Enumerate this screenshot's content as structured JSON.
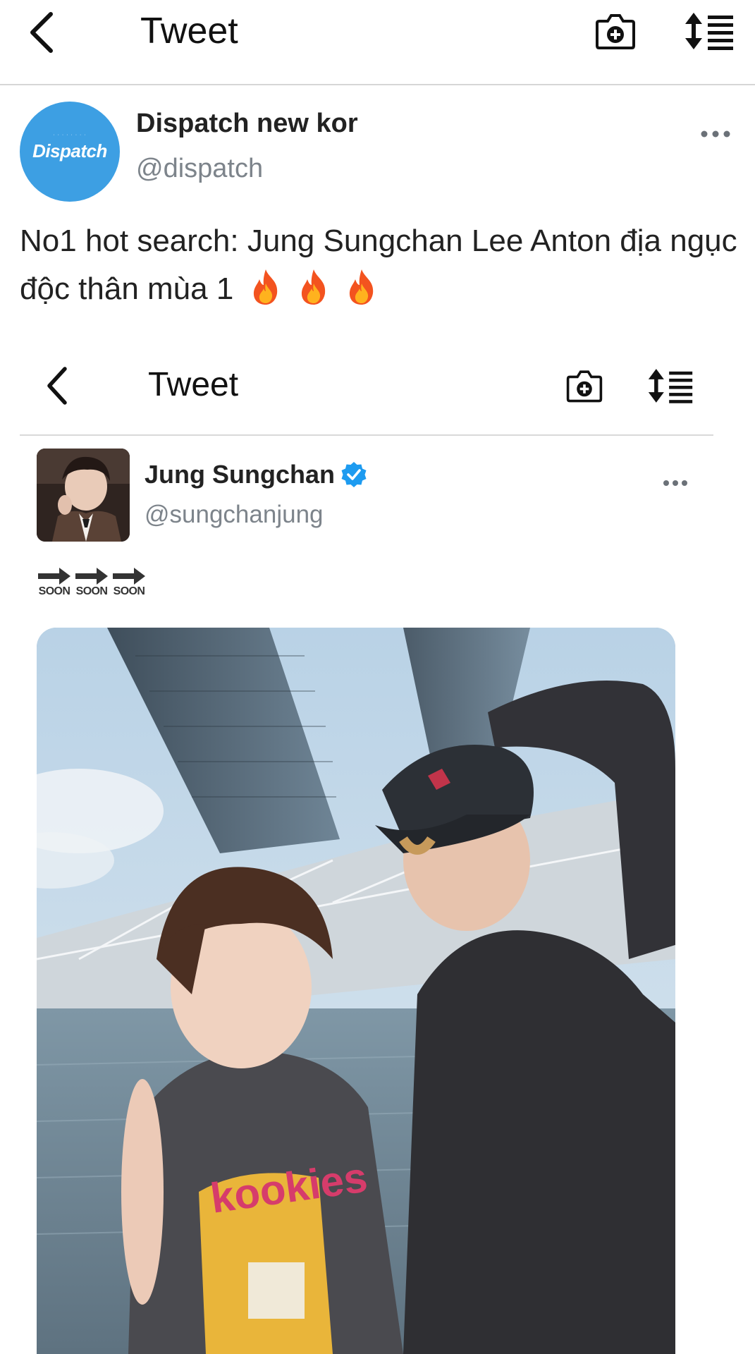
{
  "header": {
    "title": "Tweet"
  },
  "tweet": {
    "author_name": "Dispatch new kor",
    "author_handle": "@dispatch",
    "avatar_text": "Dispatch",
    "text": "No1 hot search: Jung Sungchan Lee Anton địa ngục độc thân mùa 1"
  },
  "embedded": {
    "header_title": "Tweet",
    "author_name": "Jung Sungchan",
    "author_handle": "@sungchanjung",
    "soon_labels": [
      "SOON",
      "SOON",
      "SOON"
    ]
  },
  "icons": {
    "back": "chevron-left-icon",
    "camera": "camera-plus-icon",
    "sort": "sort-list-icon",
    "more": "more-dots-icon",
    "verified": "verified-badge-icon",
    "fire": "fire-emoji-icon",
    "soon": "soon-arrow-emoji-icon"
  },
  "colors": {
    "brand_blue": "#3d9fe3",
    "verified_blue": "#1d9bf0",
    "handle_gray": "#7d848b"
  }
}
